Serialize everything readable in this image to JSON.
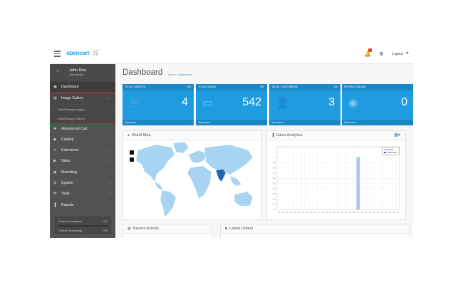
{
  "header": {
    "logo": "opencart",
    "logout_label": "Logout"
  },
  "user": {
    "name": "John Doe",
    "role": "Administrator"
  },
  "sidebar": {
    "items": [
      {
        "label": "Dashboard",
        "icon": "dashboard-icon",
        "active": true
      },
      {
        "label": "Image Gallery",
        "icon": "image-icon",
        "expanded": true
      },
      {
        "label": "Abandoned Cart",
        "icon": "plus-icon"
      },
      {
        "label": "Catalog",
        "icon": "tag-icon"
      },
      {
        "label": "Extensions",
        "icon": "puzzle-icon"
      },
      {
        "label": "Sales",
        "icon": "cart-icon"
      },
      {
        "label": "Marketing",
        "icon": "share-icon"
      },
      {
        "label": "System",
        "icon": "gear-icon"
      },
      {
        "label": "Tools",
        "icon": "wrench-icon"
      },
      {
        "label": "Reports",
        "icon": "bar-chart-icon"
      }
    ],
    "gallery_sub": [
      "Add/Manage Images",
      "Add/Manage Gallery"
    ],
    "stats": [
      {
        "label": "Orders Completed",
        "pct": "0%",
        "fill": 0
      },
      {
        "label": "Orders Processing",
        "pct": "0%",
        "fill": 0
      }
    ]
  },
  "page": {
    "title": "Dashboard",
    "breadcrumb_home": "Home",
    "breadcrumb_sep": " / ",
    "breadcrumb_current": "Dashboard"
  },
  "tiles": [
    {
      "label": "TOTAL ORDERS",
      "pct": "0%",
      "value": "4",
      "icon": "cart-icon",
      "link": "View more..."
    },
    {
      "label": "TOTAL SALES",
      "pct": "0%",
      "value": "542",
      "icon": "credit-card-icon",
      "link": "View more..."
    },
    {
      "label": "TOTAL CUSTOMERS",
      "pct": "0%",
      "value": "3",
      "icon": "user-icon",
      "link": "View more..."
    },
    {
      "label": "PEOPLE ONLINE",
      "pct": "",
      "value": "0",
      "icon": "eye-icon",
      "link": "View more..."
    }
  ],
  "world_map": {
    "title": "World Map",
    "highlight": "India"
  },
  "sales_analytics": {
    "title": "Sales Analytics",
    "legend": [
      "Orders",
      "Customers"
    ]
  },
  "chart_data": {
    "type": "bar",
    "categories": [
      "01",
      "02",
      "03",
      "04",
      "05",
      "06",
      "07",
      "08",
      "09",
      "10",
      "11",
      "12",
      "13",
      "14",
      "15",
      "16",
      "17",
      "18",
      "19",
      "20",
      "21",
      "22",
      "23",
      "24",
      "25",
      "26",
      "27",
      "28",
      "29",
      "30",
      "31"
    ],
    "series": [
      {
        "name": "Orders",
        "values": [
          0,
          0,
          0,
          0,
          0,
          0,
          0,
          0,
          0,
          0,
          0,
          0,
          0,
          0,
          0,
          0,
          0,
          0,
          0,
          0,
          0,
          0,
          0,
          0,
          0,
          0,
          0,
          0,
          0,
          0,
          0
        ]
      },
      {
        "name": "Customers",
        "values": [
          0,
          0,
          0,
          0,
          0,
          0,
          0,
          0,
          0,
          0,
          0,
          0,
          0,
          0,
          0,
          0,
          0,
          0,
          0,
          0,
          1,
          0,
          0,
          0,
          0,
          0,
          0,
          0,
          0,
          0,
          0
        ]
      }
    ],
    "yticks": [
      "0",
      "0.1",
      "0.2",
      "0.3",
      "0.4",
      "0.5",
      "0.6",
      "0.7",
      "0.8",
      "0.9",
      "1"
    ],
    "ylim": [
      0,
      1.2
    ],
    "grid": true,
    "legend_position": "top-right",
    "colors": {
      "Orders": "#a9c8ef",
      "Customers": "#1f6fd1"
    }
  },
  "bottom": {
    "recent_activity": "Recent Activity",
    "latest_orders": "Latest Orders"
  },
  "colors": {
    "accent": "#1f9be0",
    "sidebar": "#535353",
    "map_land": "#a8d4f2",
    "map_highlight": "#1e66b8",
    "gallery_outline": "#d6202a"
  }
}
